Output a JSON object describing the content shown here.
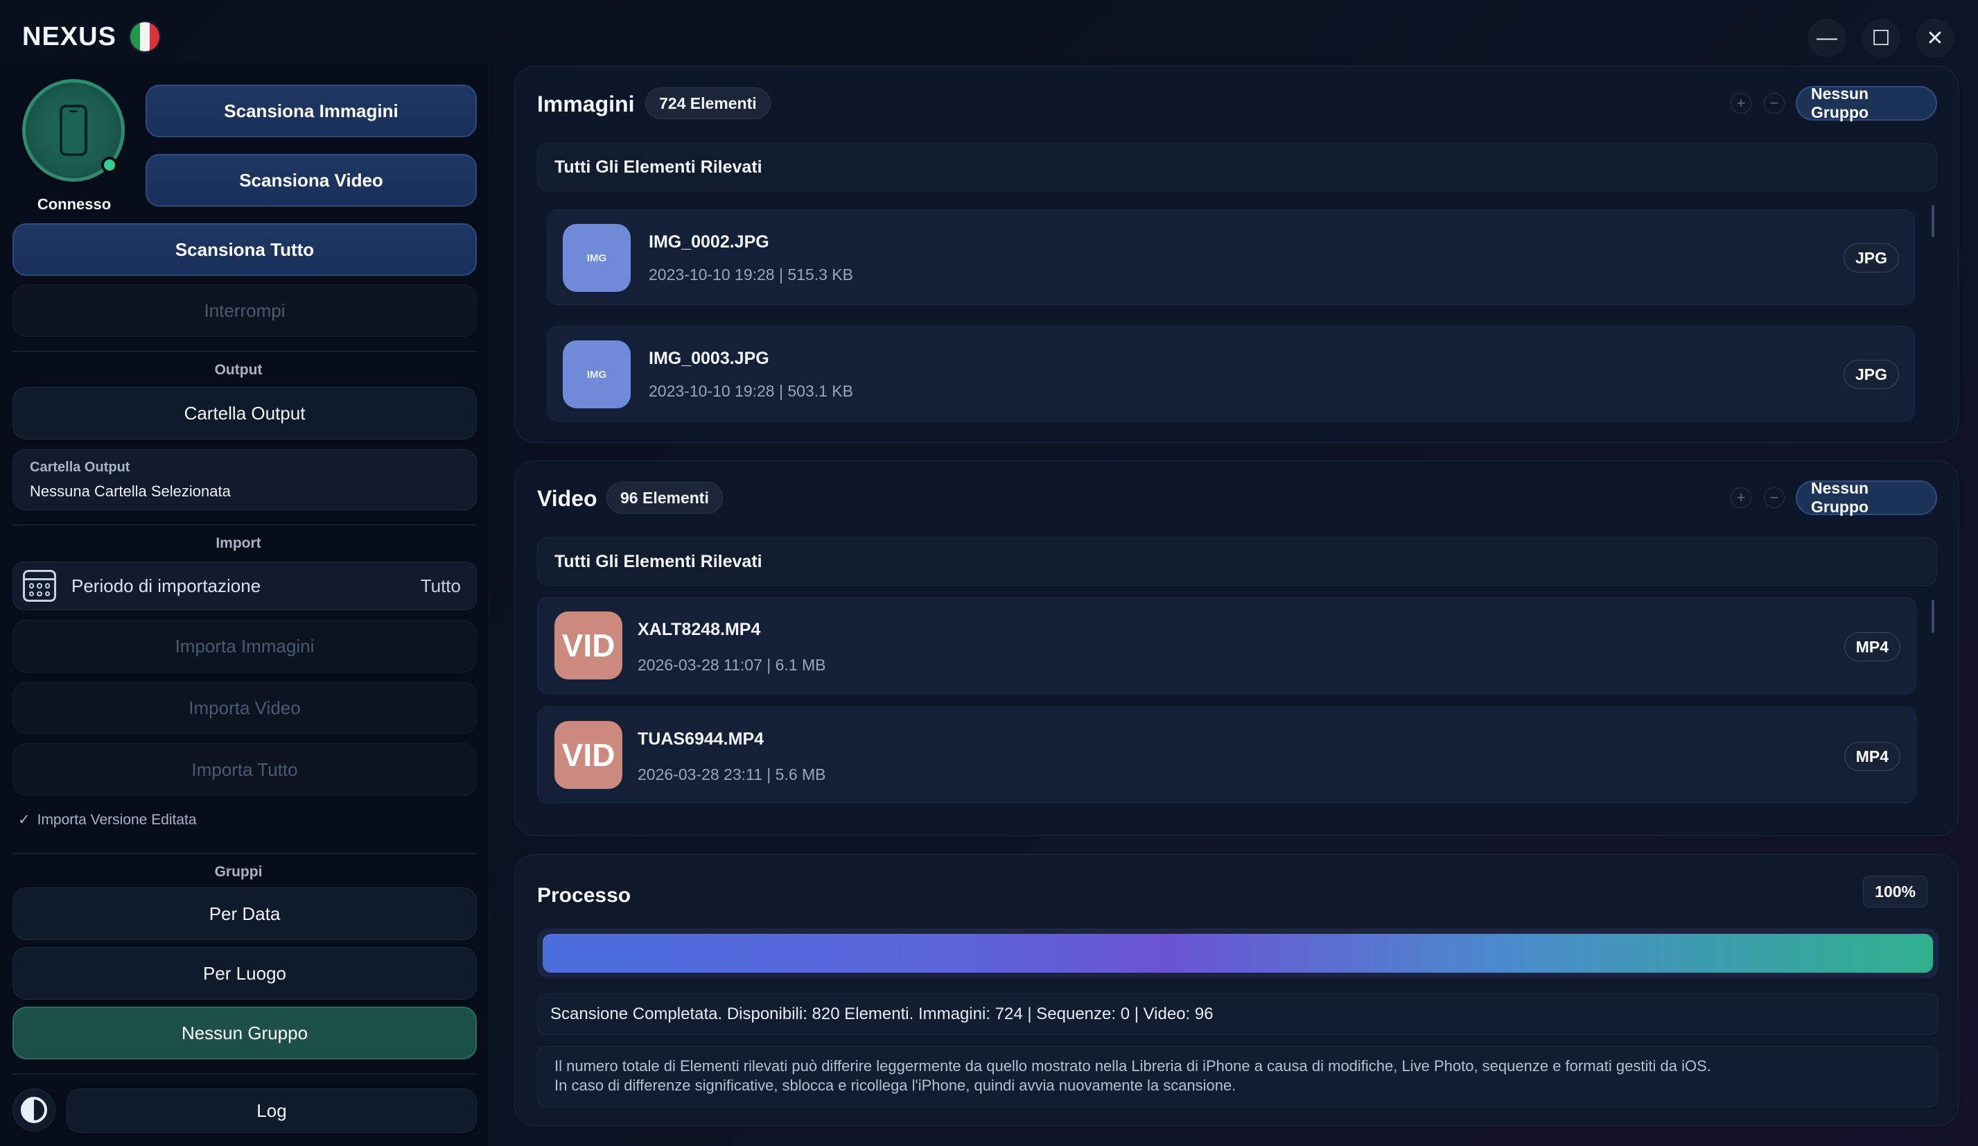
{
  "app": {
    "name": "NEXUS",
    "flag_colors": [
      "#1f9a4a",
      "#f2f2f2",
      "#d8343a"
    ]
  },
  "window_controls": {
    "minimize": "—",
    "maximize": "☐",
    "close": "✕"
  },
  "device": {
    "status": "Connesso",
    "status_color": "#2fd38f"
  },
  "sidebar": {
    "scan_images": "Scansiona Immagini",
    "scan_video": "Scansiona Video",
    "scan_all": "Scansiona Tutto",
    "stop": "Interrompi",
    "output_section": "Output",
    "output_folder_button": "Cartella Output",
    "output_field_label": "Cartella Output",
    "output_field_value": "Nessuna Cartella Selezionata",
    "import_section": "Import",
    "period_label": "Periodo di importazione",
    "period_value": "Tutto",
    "import_images": "Importa Immagini",
    "import_video": "Importa Video",
    "import_all": "Importa Tutto",
    "edited_check": "✓",
    "edited_label": "Importa Versione Editata",
    "groups_section": "Gruppi",
    "by_date": "Per Data",
    "by_place": "Per Luogo",
    "no_group": "Nessun Gruppo",
    "log": "Log"
  },
  "images": {
    "title": "Immagini",
    "count": "724 Elementi",
    "plus": "+",
    "minus": "−",
    "group": "Nessun Gruppo",
    "subheader": "Tutti Gli Elementi Rilevati",
    "items": [
      {
        "thumb": "IMG",
        "name": "IMG_0002.JPG",
        "meta": "2023-10-10 19:28 | 515.3 KB",
        "type": "JPG"
      },
      {
        "thumb": "IMG",
        "name": "IMG_0003.JPG",
        "meta": "2023-10-10 19:28 | 503.1 KB",
        "type": "JPG"
      }
    ]
  },
  "video": {
    "title": "Video",
    "count": "96 Elementi",
    "plus": "+",
    "minus": "−",
    "group": "Nessun Gruppo",
    "subheader": "Tutti Gli Elementi Rilevati",
    "items": [
      {
        "thumb": "VID",
        "name": "XALT8248.MP4",
        "meta": "2026-03-28 11:07 | 6.1 MB",
        "type": "MP4"
      },
      {
        "thumb": "VID",
        "name": "TUAS6944.MP4",
        "meta": "2026-03-28 23:11 | 5.6 MB",
        "type": "MP4"
      }
    ]
  },
  "process": {
    "title": "Processo",
    "percent_label": "100%",
    "progress_fraction": 1.0,
    "status": "Scansione Completata. Disponibili: 820 Elementi. Immagini: 724 | Sequenze: 0 | Video: 96",
    "note_line1": "Il numero totale di Elementi rilevati può differire leggermente da quello mostrato nella Libreria di iPhone a causa di modifiche, Live Photo, sequenze e formati gestiti da iOS.",
    "note_line2": "In caso di differenze significative, sblocca e ricollega l'iPhone, quindi avvia nuovamente la scansione."
  }
}
